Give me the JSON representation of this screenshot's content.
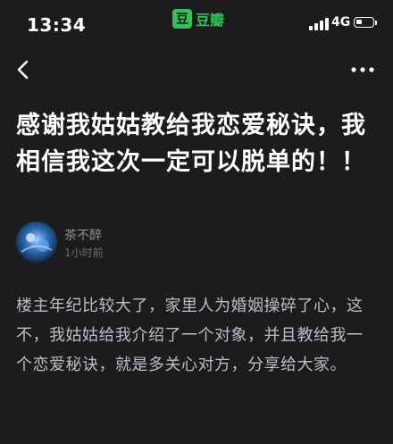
{
  "status_bar": {
    "time": "13:34",
    "network": "4G",
    "battery_level": 0.4,
    "signal_bars": 4
  },
  "brand": {
    "logo_char": "豆",
    "name": "豆瓣"
  },
  "nav": {
    "back_icon": "chevron-left-icon",
    "more_icon": "more-dots-icon"
  },
  "post": {
    "title": "感谢我姑姑教给我恋爱秘诀，我相信我这次一定可以脱单的！！",
    "author": "茶不醉",
    "time": "1小时前",
    "body": "楼主年纪比较大了，家里人为婚姻操碎了心，这不，我姑姑给我介绍了一个对象，并且教给我一个恋爱秘诀，就是多关心对方，分享给大家。"
  },
  "colors": {
    "background": "#1c1c1e",
    "brand_green": "#33c25a",
    "meta_text": "#8e8e93",
    "body_text": "#bdbdc2"
  }
}
